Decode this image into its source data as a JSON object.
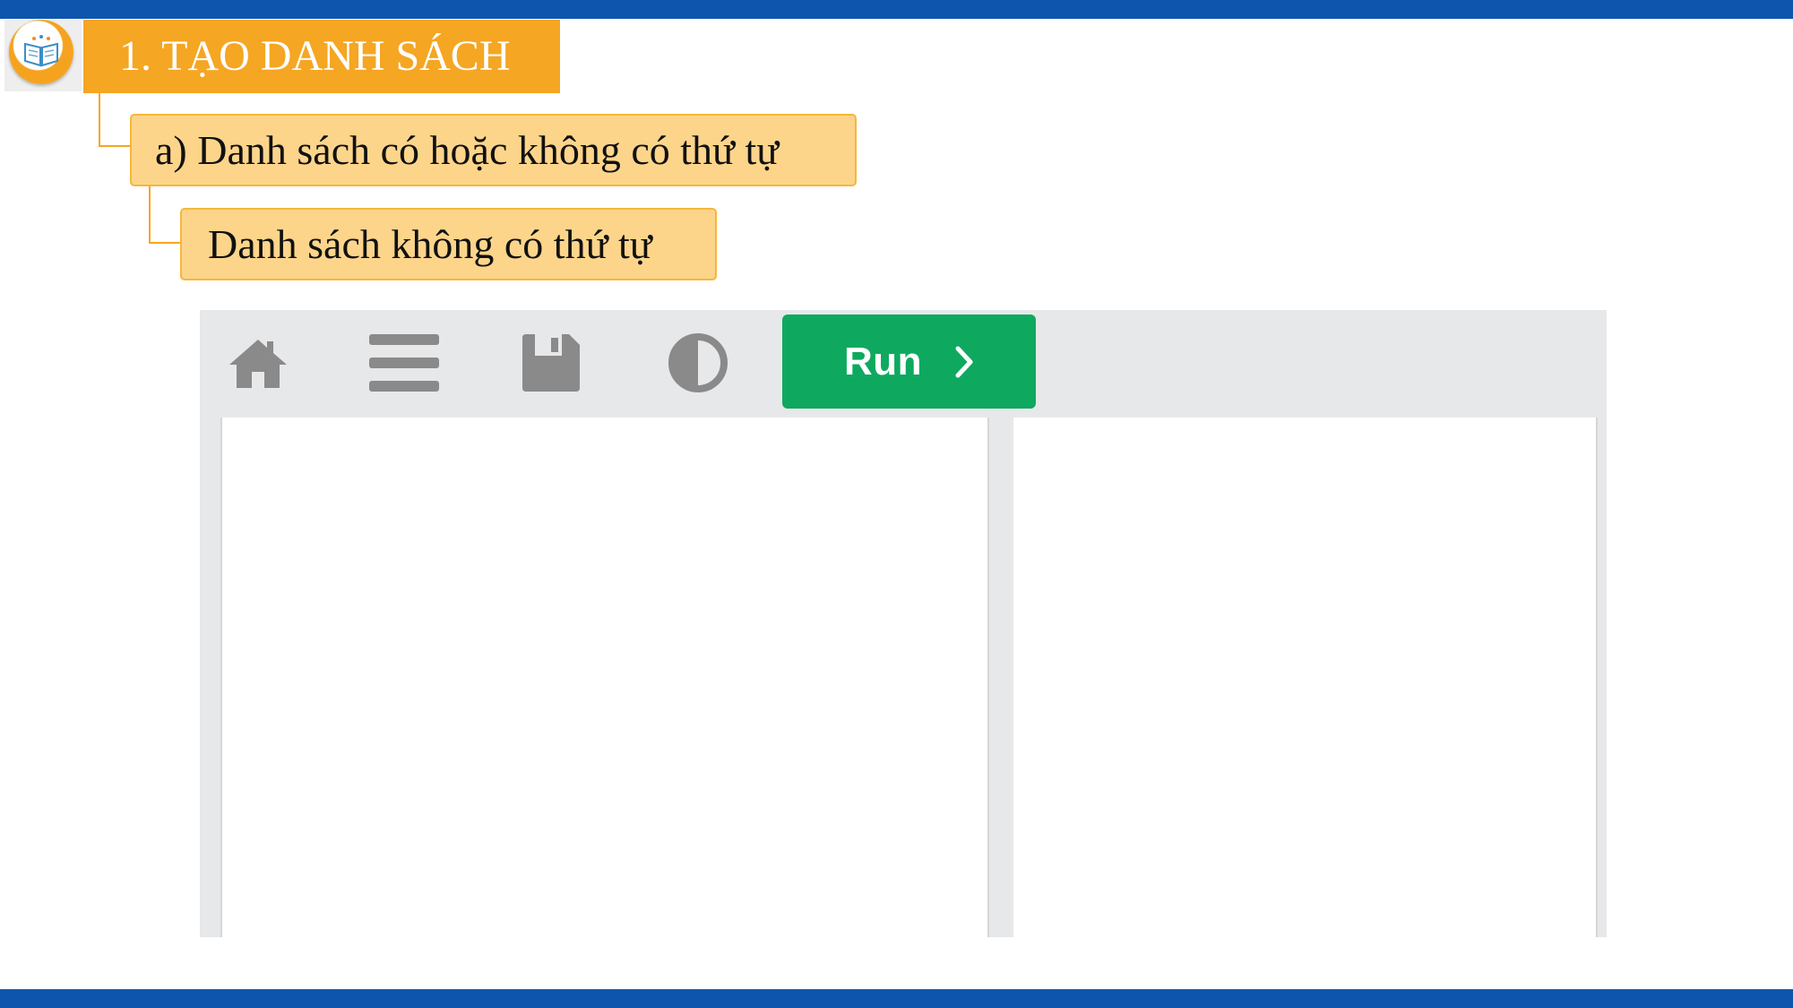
{
  "slide": {
    "title": "1. TẠO DANH SÁCH",
    "subtitle_a": "a) Danh sách có hoặc không có thứ tự",
    "subtitle_b": "Danh sách không có thứ tự",
    "logo_icon": "open-book-icon"
  },
  "toolbar": {
    "icons": [
      "home-icon",
      "menu-icon",
      "save-icon",
      "contrast-icon"
    ],
    "run_label": "Run",
    "run_icon": "chevron-right-icon"
  },
  "colors": {
    "frame_blue": "#0e56ad",
    "banner_orange": "#f5a623",
    "box_fill": "#fcd58b",
    "run_green": "#0ea95f",
    "toolbar_bg": "#e7e8ea",
    "icon_gray": "#8a8a8a"
  },
  "editor": {
    "code_pane_text": "",
    "preview_pane_text": ""
  }
}
